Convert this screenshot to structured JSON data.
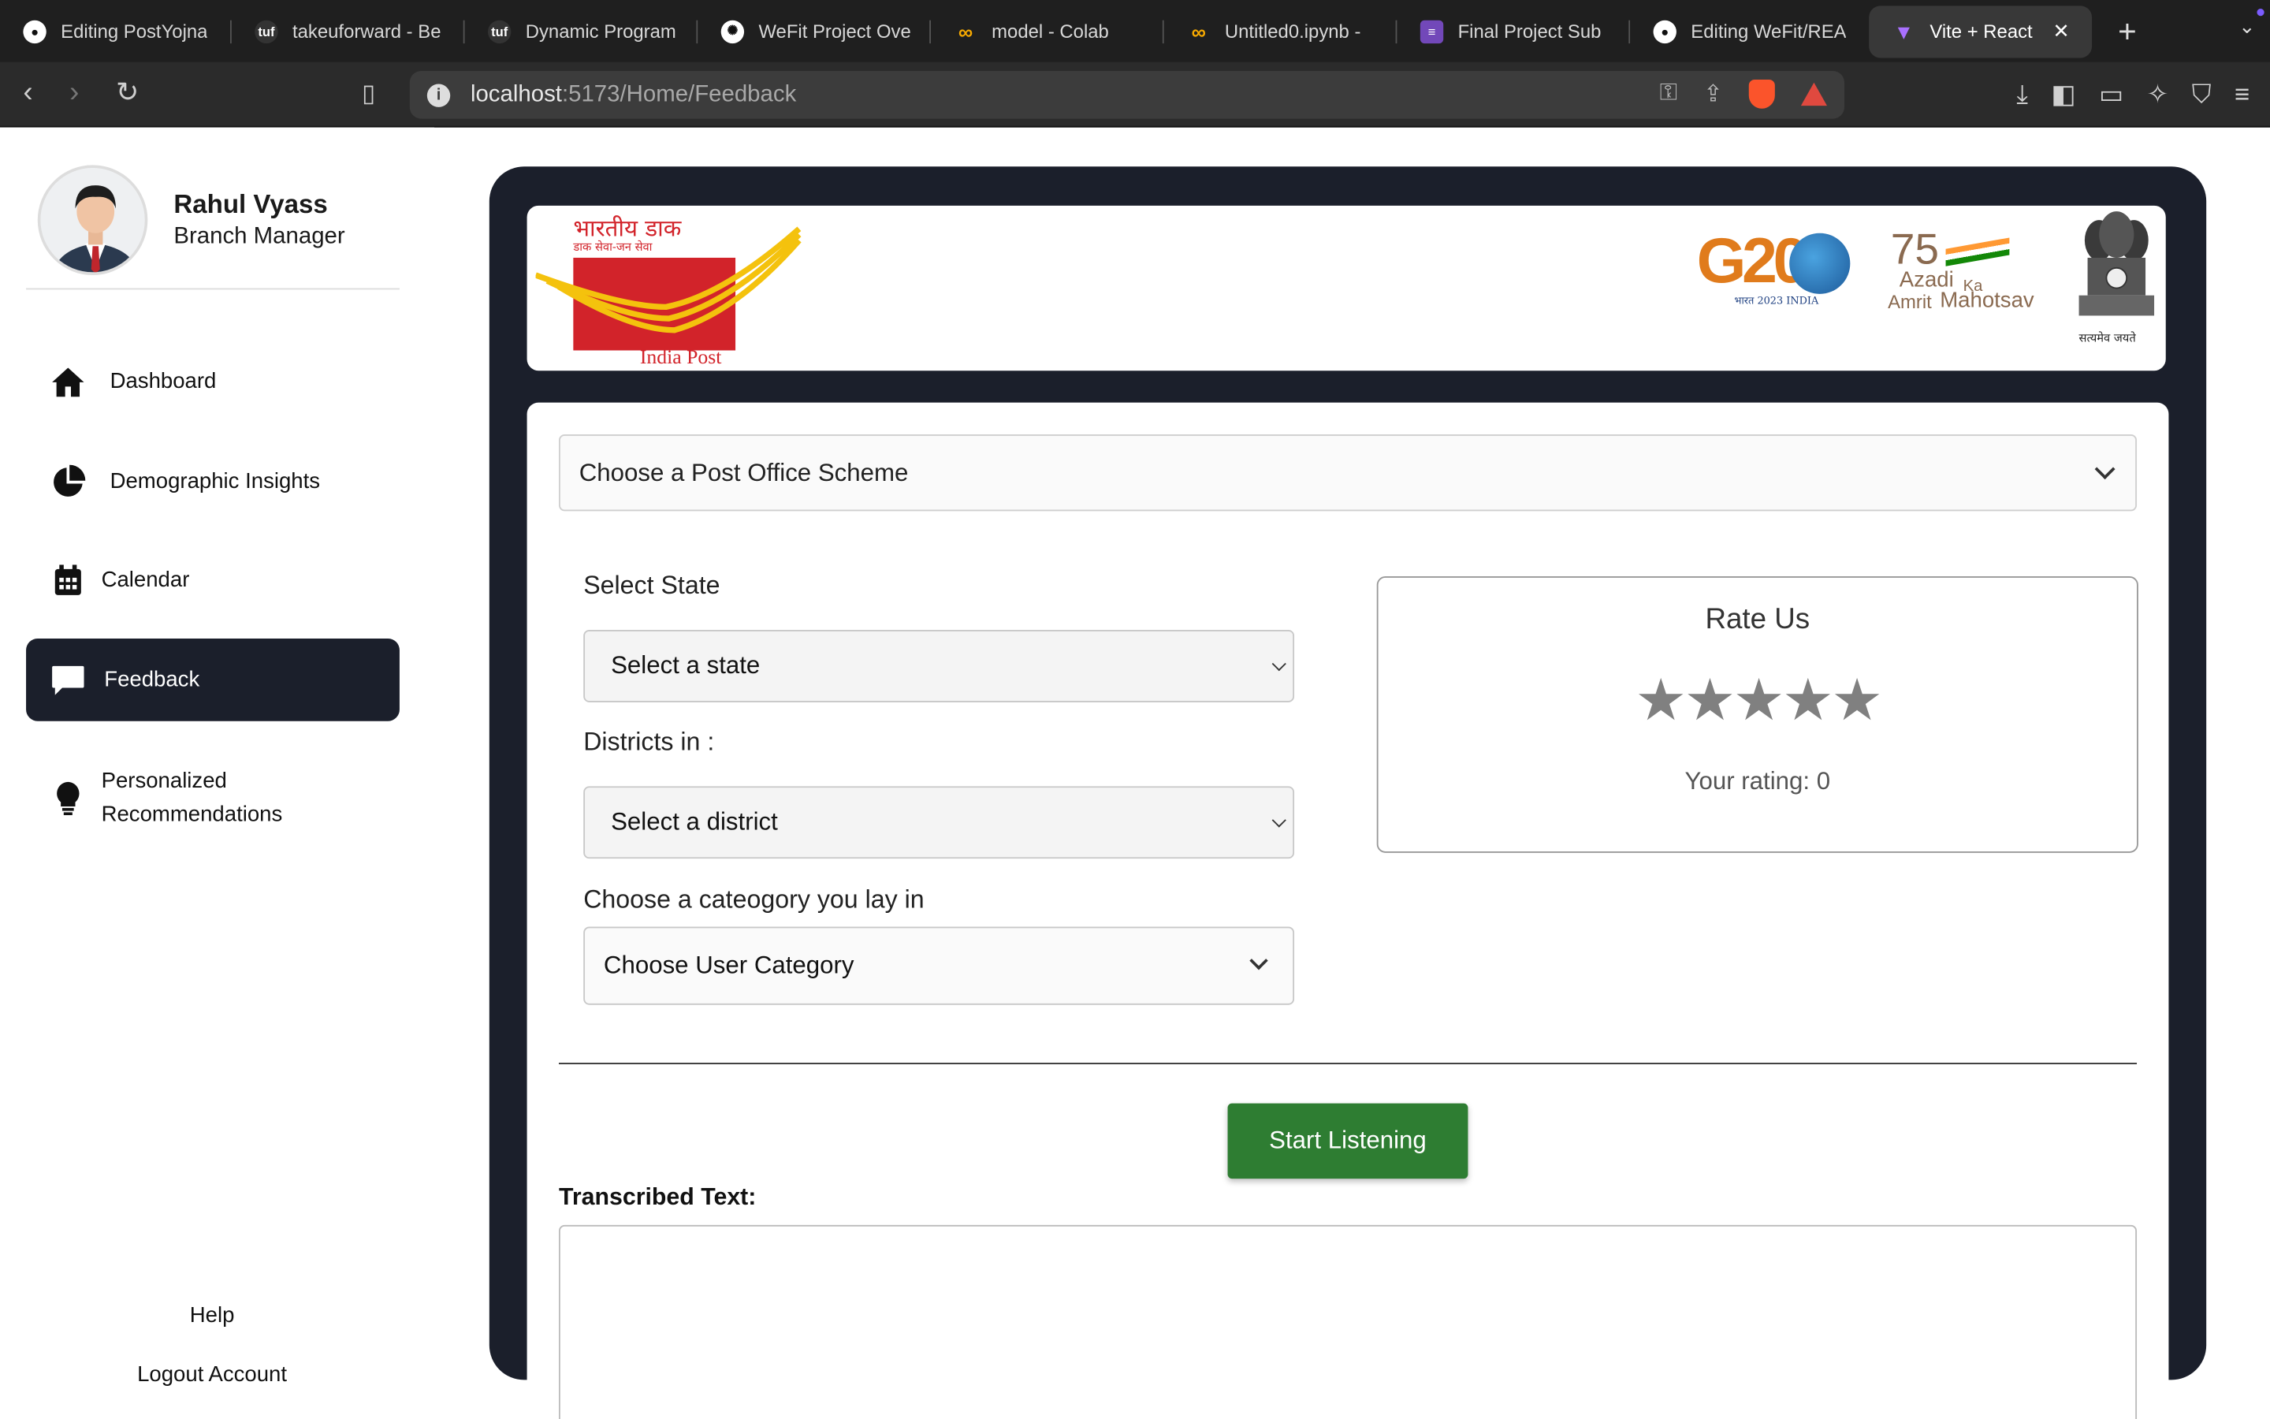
{
  "browser": {
    "tabs": [
      {
        "label": "Editing PostYojna",
        "icon": "github-icon"
      },
      {
        "label": "takeuforward - Be",
        "icon": "tuf-icon"
      },
      {
        "label": "Dynamic Program",
        "icon": "tuf-icon"
      },
      {
        "label": "WeFit Project Ove",
        "icon": "openai-icon"
      },
      {
        "label": "model - Colab",
        "icon": "colab-icon"
      },
      {
        "label": "Untitled0.ipynb -",
        "icon": "colab-icon"
      },
      {
        "label": "Final Project Sub",
        "icon": "forms-icon"
      },
      {
        "label": "Editing WeFit/REA",
        "icon": "github-icon"
      }
    ],
    "active_tab": {
      "label": "Vite + React",
      "icon": "vite-icon"
    },
    "url_host": "localhost",
    "url_path": ":5173/Home/Feedback"
  },
  "sidebar": {
    "user_name": "Rahul Vyass",
    "user_role": "Branch Manager",
    "items": [
      {
        "label": "Dashboard",
        "icon": "home-icon"
      },
      {
        "label": "Demographic Insights",
        "icon": "pie-chart-icon"
      },
      {
        "label": "Calendar",
        "icon": "calendar-icon"
      },
      {
        "label": "Feedback",
        "icon": "chat-icon"
      },
      {
        "label_line1": "Personalized",
        "label_line2": "Recommendations",
        "icon": "lightbulb-icon"
      }
    ],
    "help": "Help",
    "logout": "Logout Account"
  },
  "banner": {
    "hindi_title": "भारतीय डाक",
    "hindi_tagline": "डाक सेवा-जन सेवा",
    "india_post": "India Post",
    "g20_text": "G20",
    "g20_sub": "भारत 2023 INDIA",
    "azadi_75": "75",
    "azadi_1": "Azadi",
    "azadi_ka": "Ka",
    "azadi_2": "Amrit",
    "azadi_3": "Mahotsav",
    "emblem_motto": "सत्यमेव जयते"
  },
  "form": {
    "scheme_placeholder": "Choose a Post Office Scheme",
    "state_label": "Select State",
    "state_placeholder": "Select a state",
    "district_label": "Districts in :",
    "district_placeholder": "Select a district",
    "category_label": "Choose a cateogory you lay in",
    "category_placeholder": "Choose User Category",
    "listen_button": "Start Listening",
    "transcribed_label": "Transcribed Text:"
  },
  "rating": {
    "title": "Rate Us",
    "stars": "★★★★★",
    "star_count": 5,
    "value": 0,
    "rating_text": "Your rating: 0"
  },
  "colors": {
    "panel": "#1b1f2b",
    "active_nav": "#1b1f2b",
    "listen_button": "#2e7d32",
    "star": "#808080",
    "india_post_red": "#d2232a",
    "india_post_yellow": "#f4c20d"
  }
}
